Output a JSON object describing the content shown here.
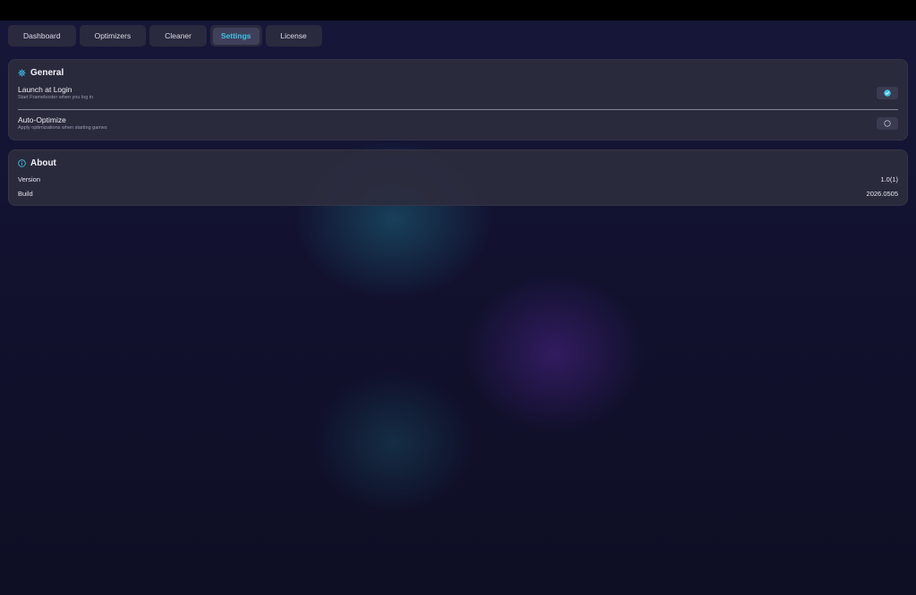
{
  "tabs": [
    {
      "label": "Dashboard"
    },
    {
      "label": "Optimizers"
    },
    {
      "label": "Cleaner"
    },
    {
      "label": "Settings"
    },
    {
      "label": "License"
    }
  ],
  "active_tab": "Settings",
  "general": {
    "title": "General",
    "icon": "gear-icon",
    "launch_at_login": {
      "label": "Launch at Login",
      "description": "Start Frameboster when you log in",
      "checked": true
    },
    "auto_optimize": {
      "label": "Auto-Optimize",
      "description": "Apply optimizations when starting games",
      "checked": false
    }
  },
  "about": {
    "title": "About",
    "icon": "info-icon",
    "version_label": "Version",
    "version_value": "1.0(1)",
    "build_label": "Build",
    "build_value": "2026.0505"
  },
  "colors": {
    "accent": "#3fc1e8",
    "card_bg": "#2c2c3e",
    "titlebar": "#000000"
  }
}
